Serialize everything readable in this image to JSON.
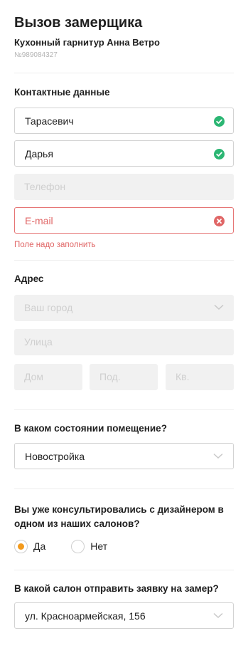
{
  "header": {
    "title": "Вызов замерщика",
    "product_name": "Кухонный гарнитур Анна Ветро",
    "sku": "№989084327"
  },
  "contacts": {
    "section_title": "Контактные данные",
    "last_name_value": "Тарасевич",
    "first_name_value": "Дарья",
    "phone_placeholder": "Телефон",
    "email_placeholder": "E-mail",
    "email_error": "Поле надо заполнить"
  },
  "address": {
    "section_title": "Адрес",
    "city_placeholder": "Ваш город",
    "street_placeholder": "Улица",
    "house_placeholder": "Дом",
    "entrance_placeholder": "Под.",
    "apartment_placeholder": "Кв."
  },
  "room_state": {
    "question": "В каком состоянии помещение?",
    "selected": "Новостройка"
  },
  "designer": {
    "question": "Вы уже консультировались с дизайнером в одном из наших салонов?",
    "option_yes": "Да",
    "option_no": "Нет",
    "selected": "yes"
  },
  "salon": {
    "question": "В какой салон отправить заявку на замер?",
    "selected": "ул. Красноармейская, 156"
  },
  "colors": {
    "success": "#2bb673",
    "error": "#e06666",
    "accent": "#f39a1c"
  }
}
